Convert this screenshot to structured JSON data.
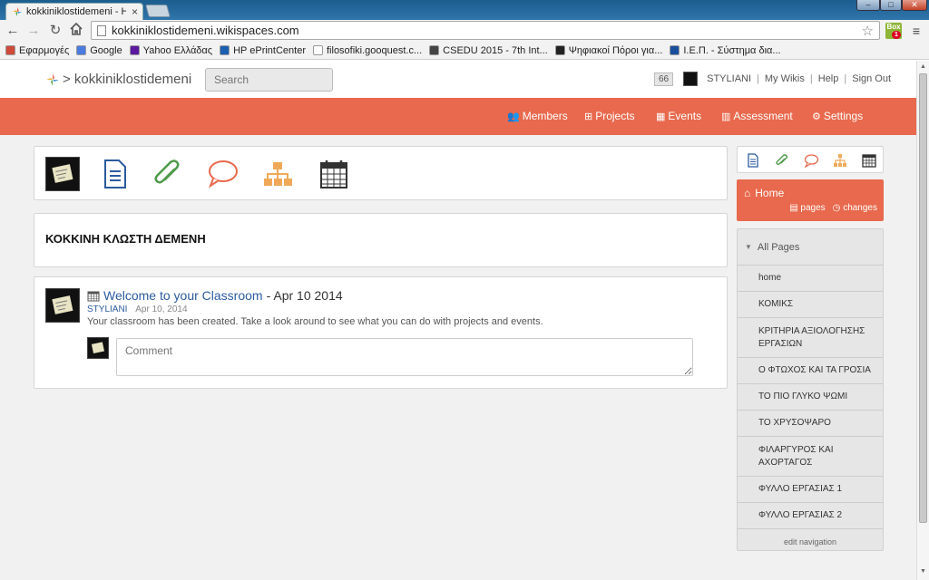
{
  "browser": {
    "tab_title": "kokkiniklostidemeni - Hor",
    "tab_close": "×",
    "url": "kokkiniklostidemeni.wikispaces.com",
    "extension_label": "Box",
    "extension_badge": "1",
    "window_controls": {
      "minimize": "–",
      "maximize": "□",
      "close": "✕"
    },
    "nav": {
      "back": "←",
      "forward": "→",
      "reload": "↻",
      "star": "☆",
      "menu": "≡"
    },
    "bookmarks": [
      {
        "label": "Εφαρμογές",
        "color": "#d04a3a"
      },
      {
        "label": "Google",
        "color": "#4a7be0"
      },
      {
        "label": "Yahoo Ελλάδας",
        "color": "#5b1aa0"
      },
      {
        "label": "HP ePrintCenter",
        "color": "#1b5fb0"
      },
      {
        "label": "filosofiki.gooquest.c...",
        "color": "#ffffff"
      },
      {
        "label": "CSEDU 2015 - 7th Int...",
        "color": "#444444"
      },
      {
        "label": "Ψηφιακοί Πόροι για...",
        "color": "#222222"
      },
      {
        "label": "Ι.Ε.Π. - Σύστημα δια...",
        "color": "#1a4f9e"
      }
    ]
  },
  "header": {
    "site_name": "> kokkiniklostidemeni",
    "search_placeholder": "Search",
    "badge_count": "66",
    "username": "STYLIANI",
    "links": [
      "My Wikis",
      "Help",
      "Sign Out"
    ],
    "separator": "|"
  },
  "nav_bar": {
    "accent": "#e8694d",
    "items": [
      {
        "label": "Members",
        "icon": "users-icon",
        "glyph": "👥"
      },
      {
        "label": "Projects",
        "icon": "sitemap-icon",
        "glyph": "⊞"
      },
      {
        "label": "Events",
        "icon": "calendar-icon",
        "glyph": "▦"
      },
      {
        "label": "Assessment",
        "icon": "chart-icon",
        "glyph": "▥"
      },
      {
        "label": "Settings",
        "icon": "gear-icon",
        "glyph": "⚙"
      }
    ]
  },
  "toolbar_icons": [
    "avatar-icon",
    "page-icon",
    "paperclip-icon",
    "comment-icon",
    "sitemap-icon",
    "calendar-icon"
  ],
  "wiki": {
    "title": "ΚΟΚΚΙΝΗ ΚΛΩΣΤΗ ΔΕΜΕΝΗ"
  },
  "feed": {
    "entry_link": "Welcome to your Classroom",
    "entry_date_suffix": "- Apr 10 2014",
    "author": "STYLIANI",
    "date": "Apr 10, 2014",
    "body": "Your classroom has been created. Take a look around to see what you can do with projects and events.",
    "comment_placeholder": "Comment"
  },
  "sidebar": {
    "home_label": "Home",
    "pages_label": "pages",
    "changes_label": "changes",
    "all_pages_label": "All Pages",
    "items": [
      "home",
      "ΚΟΜΙΚΣ",
      "ΚΡΙΤΗΡΙΑ ΑΞΙΟΛΟΓΗΣΗΣ ΕΡΓΑΣΙΩΝ",
      "Ο ΦΤΩΧΟΣ ΚΑΙ ΤΑ ΓΡΟΣΙΑ",
      "ΤΟ ΠΙΟ ΓΛΥΚΟ ΨΩΜΙ",
      "ΤΟ ΧΡΥΣΟΨΑΡΟ",
      "ΦΙΛΑΡΓΥΡΟΣ ΚΑΙ ΑΧΟΡΤΑΓΟΣ",
      "ΦΥΛΛΟ ΕΡΓΑΣΙΑΣ 1",
      "ΦΥΛΛΟ ΕΡΓΑΣΙΑΣ 2"
    ],
    "edit_navigation": "edit navigation"
  }
}
